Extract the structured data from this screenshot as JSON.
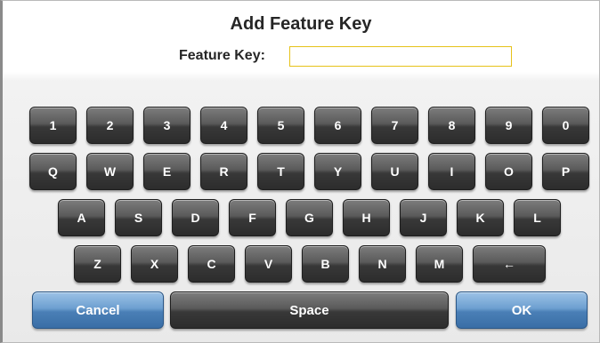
{
  "dialog": {
    "title": "Add Feature Key",
    "feature_key_label": "Feature Key:",
    "feature_key_value": ""
  },
  "keyboard": {
    "row1": [
      "1",
      "2",
      "3",
      "4",
      "5",
      "6",
      "7",
      "8",
      "9",
      "0"
    ],
    "row2": [
      "Q",
      "W",
      "E",
      "R",
      "T",
      "Y",
      "U",
      "I",
      "O",
      "P"
    ],
    "row3": [
      "A",
      "S",
      "D",
      "F",
      "G",
      "H",
      "J",
      "K",
      "L"
    ],
    "row4": [
      "Z",
      "X",
      "C",
      "V",
      "B",
      "N",
      "M"
    ],
    "backspace_glyph": "←"
  },
  "actions": {
    "cancel_label": "Cancel",
    "space_label": "Space",
    "ok_label": "OK"
  },
  "colors": {
    "input_border": "#e6c21a",
    "key_dark": "#383838",
    "action_blue": "#4a7fb6"
  }
}
